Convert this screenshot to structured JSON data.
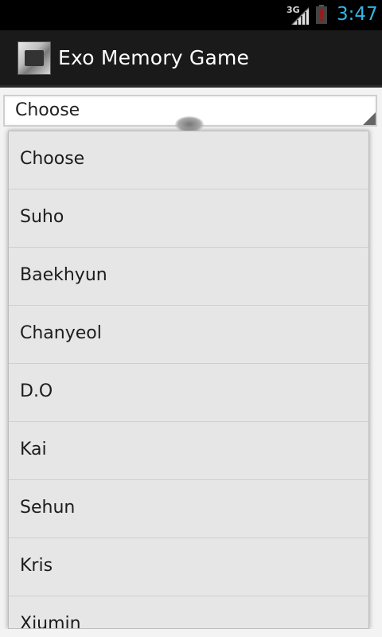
{
  "status_bar": {
    "network": "3G",
    "time": "3:47",
    "signal_icon": "signal-icon",
    "battery_icon": "battery-alert-icon",
    "colors": {
      "clock": "#33b5e5",
      "battery_alert": "#cc0000"
    }
  },
  "action_bar": {
    "title": "Exo Memory Game",
    "icon": "app-icon"
  },
  "spinner": {
    "selected": "Choose"
  },
  "popup": {
    "items": [
      {
        "label": "Choose"
      },
      {
        "label": "Suho"
      },
      {
        "label": "Baekhyun"
      },
      {
        "label": "Chanyeol"
      },
      {
        "label": "D.O"
      },
      {
        "label": "Kai"
      },
      {
        "label": "Sehun"
      },
      {
        "label": "Kris"
      },
      {
        "label": "Xiumin"
      }
    ]
  }
}
